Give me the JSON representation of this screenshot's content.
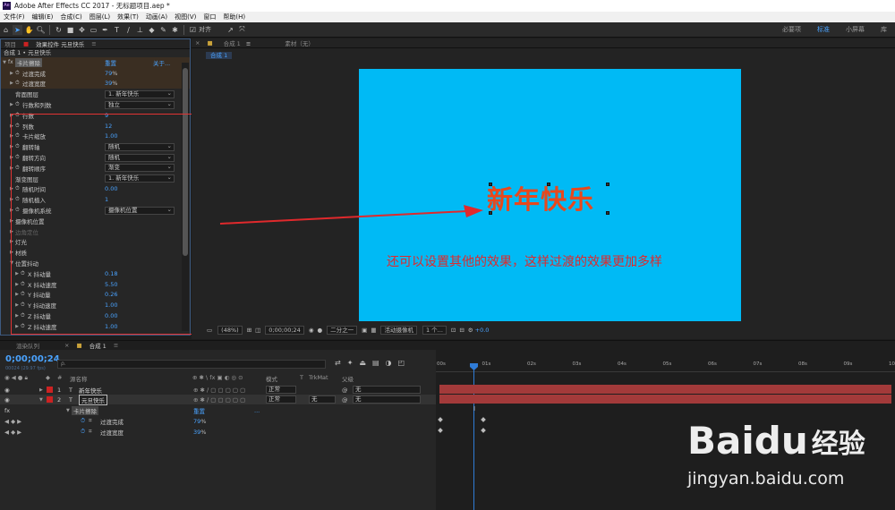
{
  "app": {
    "logo": "Ae",
    "title": "Adobe After Effects CC 2017 - 无标题项目.aep *"
  },
  "menu": [
    "文件(F)",
    "编辑(E)",
    "合成(C)",
    "图层(L)",
    "效果(T)",
    "动画(A)",
    "视图(V)",
    "窗口",
    "帮助(H)"
  ],
  "toolbar": {
    "align_label": "对齐",
    "workspaces": [
      "必要项",
      "标准",
      "小屏幕",
      "库"
    ]
  },
  "effects_panel": {
    "tabs": [
      "项目",
      "效果控件 元旦快乐"
    ],
    "crumb": "合成 1 • 元旦快乐",
    "effect": {
      "name": "卡片擦除",
      "reset": "重置",
      "about": "关于..."
    },
    "params": [
      {
        "label": "过渡完成",
        "value": "79",
        "unit": "%"
      },
      {
        "label": "过渡宽度",
        "value": "39",
        "unit": "%"
      },
      {
        "label": "背面图层",
        "dropdown": "1. 新年快乐"
      },
      {
        "label": "行数和列数",
        "dropdown": "独立"
      },
      {
        "label": "行数",
        "value": "9"
      },
      {
        "label": "列数",
        "value": "12"
      },
      {
        "label": "卡片缩放",
        "value": "1.00"
      },
      {
        "label": "翻转轴",
        "dropdown": "随机"
      },
      {
        "label": "翻转方向",
        "dropdown": "随机"
      },
      {
        "label": "翻转顺序",
        "dropdown": "渐变"
      },
      {
        "label": "渐变图层",
        "dropdown": "1. 新年快乐"
      },
      {
        "label": "随机时间",
        "value": "0.00"
      },
      {
        "label": "随机植入",
        "value": "1"
      },
      {
        "label": "摄像机系统",
        "dropdown": "摄像机位置"
      },
      {
        "label": "摄像机位置"
      },
      {
        "label": "边角定位"
      },
      {
        "label": "灯光"
      },
      {
        "label": "材质"
      },
      {
        "label": "位置抖动"
      },
      {
        "label": "X 抖动量",
        "value": "0.18"
      },
      {
        "label": "X 抖动速度",
        "value": "5.50"
      },
      {
        "label": "Y 抖动量",
        "value": "0.26"
      },
      {
        "label": "Y 抖动速度",
        "value": "1.00"
      },
      {
        "label": "Z 抖动量",
        "value": "0.00"
      },
      {
        "label": "Z 抖动速度",
        "value": "1.00"
      }
    ]
  },
  "composition": {
    "tabs": [
      "合成 1",
      "素材（无）"
    ],
    "sub_tab": "合成 1",
    "text_layer": "新年快乐",
    "annotation": "还可以设置其他的效果，这样过渡的效果更加多样",
    "bg_color": "#00baf5",
    "viewer_bar": {
      "zoom": "(48%)",
      "timecode": "0;00;00;24",
      "resolution": "二分之一",
      "camera": "活动摄像机",
      "views": "1 个...",
      "exposure": "+0.0"
    }
  },
  "timeline": {
    "tabs": [
      "渲染队列",
      "合成 1"
    ],
    "timecode": "0;00;00;24",
    "timecode_sub": "00024 (29.97 fps)",
    "search_placeholder": "ρ.",
    "columns": {
      "name": "源名称",
      "mode": "模式",
      "t": "T",
      "trkmat": "TrkMat",
      "parent": "父级"
    },
    "layers": [
      {
        "num": "1",
        "type": "T",
        "name": "新年快乐",
        "mode": "正常",
        "trkmat": "",
        "parent": "无"
      },
      {
        "num": "2",
        "type": "T",
        "name": "元旦快乐",
        "mode": "正常",
        "trkmat": "无",
        "parent": "无"
      }
    ],
    "effect_row": {
      "name": "卡片擦除",
      "reset": "重置",
      "dots": "..."
    },
    "props": [
      {
        "name": "过渡完成",
        "value": "79",
        "unit": "%"
      },
      {
        "name": "过渡宽度",
        "value": "39",
        "unit": "%"
      }
    ],
    "ruler": [
      "00s",
      "01s",
      "02s",
      "03s",
      "04s",
      "05s",
      "06s",
      "07s",
      "08s",
      "09s",
      "10s"
    ]
  },
  "watermark": {
    "brand": "Baidu",
    "cn": "经验",
    "url": "jingyan.baidu.com"
  }
}
